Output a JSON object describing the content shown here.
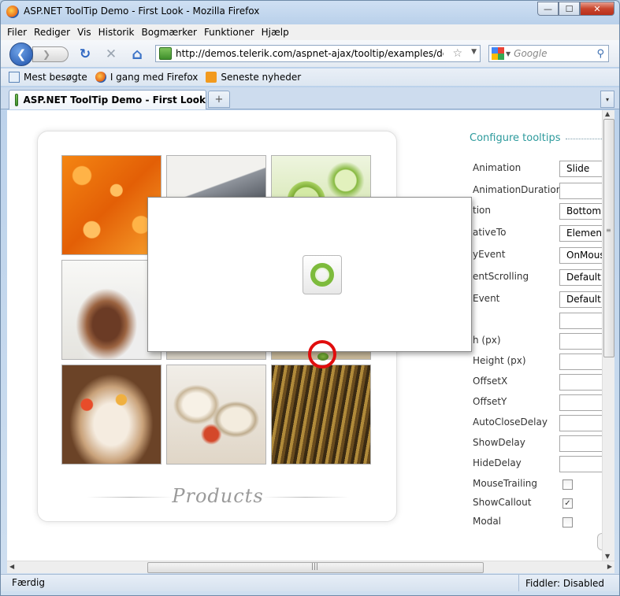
{
  "window": {
    "title": "ASP.NET ToolTip Demo - First Look - Mozilla Firefox",
    "controls": {
      "minimize": "—",
      "maximize": "☐",
      "close": "✕"
    }
  },
  "menu": {
    "items": [
      {
        "label": "Filer"
      },
      {
        "label": "Rediger"
      },
      {
        "label": "Vis"
      },
      {
        "label": "Historik"
      },
      {
        "label": "Bogmærker"
      },
      {
        "label": "Funktioner"
      },
      {
        "label": "Hjælp"
      }
    ]
  },
  "nav": {
    "back": "❮",
    "forward": "❯",
    "reload": "↻",
    "stop": "✕",
    "home": "⌂",
    "url": "http://demos.telerik.com/aspnet-ajax/tooltip/examples/default/d",
    "search_placeholder": "Google"
  },
  "bookmarks": {
    "items": [
      {
        "label": "Mest besøgte",
        "icon": "page-icon"
      },
      {
        "label": "I gang med Firefox",
        "icon": "firefox-icon"
      },
      {
        "label": "Seneste nyheder",
        "icon": "rss-icon"
      }
    ]
  },
  "tabs": {
    "active_label": "ASP.NET ToolTip Demo - First Look",
    "new_tab": "+",
    "list_all": "▾"
  },
  "products": {
    "label": "Products"
  },
  "config": {
    "title": "Configure tooltips",
    "rows": [
      {
        "label": "Animation",
        "value": "Slide",
        "kind": "select"
      },
      {
        "label": "AnimationDuration",
        "value": "",
        "kind": "text"
      },
      {
        "label": "tion",
        "value": "Bottom",
        "kind": "select"
      },
      {
        "label": "ativeTo",
        "value": "Element",
        "kind": "select"
      },
      {
        "label": "yEvent",
        "value": "OnMous",
        "kind": "select"
      },
      {
        "label": "entScrolling",
        "value": "Default",
        "kind": "select"
      },
      {
        "label": "Event",
        "value": "Default",
        "kind": "select"
      },
      {
        "label": "",
        "value": "",
        "kind": "text"
      },
      {
        "label": "h (px)",
        "value": "",
        "kind": "text"
      },
      {
        "label": "Height (px)",
        "value": "",
        "kind": "text"
      },
      {
        "label": "OffsetX",
        "value": "",
        "kind": "text"
      },
      {
        "label": "OffsetY",
        "value": "",
        "kind": "text"
      },
      {
        "label": "AutoCloseDelay",
        "value": "",
        "kind": "text"
      },
      {
        "label": "ShowDelay",
        "value": "",
        "kind": "text"
      },
      {
        "label": "HideDelay",
        "value": "",
        "kind": "text"
      }
    ],
    "checks": [
      {
        "label": "MouseTrailing",
        "checked": false
      },
      {
        "label": "ShowCallout",
        "checked": true
      },
      {
        "label": "Modal",
        "checked": false
      }
    ]
  },
  "status": {
    "text": "Færdig",
    "fiddler": "Fiddler: Disabled"
  }
}
